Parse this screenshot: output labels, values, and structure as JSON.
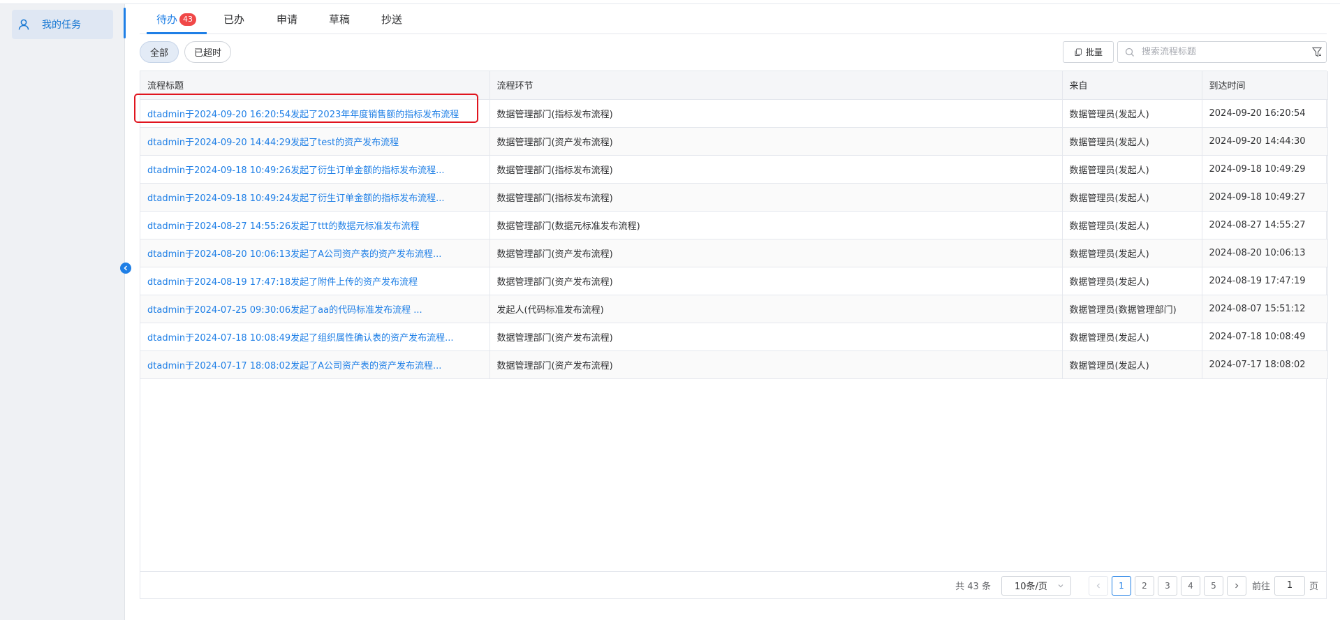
{
  "colors": {
    "accent": "#1f7fe6",
    "badge": "#f04848",
    "highlight": "#e0141e"
  },
  "sidebar": {
    "items": [
      {
        "label": "我的任务",
        "icon": "user-icon"
      }
    ]
  },
  "tabs": [
    {
      "label": "待办",
      "badge": "43",
      "active": true
    },
    {
      "label": "已办"
    },
    {
      "label": "申请"
    },
    {
      "label": "草稿"
    },
    {
      "label": "抄送"
    }
  ],
  "filters": {
    "all": "全部",
    "overdue": "已超时"
  },
  "toolbar": {
    "batch_label": "批量",
    "search_placeholder": "搜索流程标题"
  },
  "table": {
    "columns": [
      "流程标题",
      "流程环节",
      "来自",
      "到达时间"
    ],
    "rows": [
      [
        "dtadmin于2024-09-20 16:20:54发起了2023年年度销售额的指标发布流程",
        "数据管理部门(指标发布流程)",
        "数据管理员(发起人)",
        "2024-09-20 16:20:54"
      ],
      [
        "dtadmin于2024-09-20 14:44:29发起了test的资产发布流程",
        "数据管理部门(资产发布流程)",
        "数据管理员(发起人)",
        "2024-09-20 14:44:30"
      ],
      [
        "dtadmin于2024-09-18 10:49:26发起了衍生订单金额的指标发布流程...",
        "数据管理部门(指标发布流程)",
        "数据管理员(发起人)",
        "2024-09-18 10:49:29"
      ],
      [
        "dtadmin于2024-09-18 10:49:24发起了衍生订单金额的指标发布流程...",
        "数据管理部门(指标发布流程)",
        "数据管理员(发起人)",
        "2024-09-18 10:49:27"
      ],
      [
        "dtadmin于2024-08-27 14:55:26发起了ttt的数据元标准发布流程",
        "数据管理部门(数据元标准发布流程)",
        "数据管理员(发起人)",
        "2024-08-27 14:55:27"
      ],
      [
        "dtadmin于2024-08-20 10:06:13发起了A公司资产表的资产发布流程...",
        "数据管理部门(资产发布流程)",
        "数据管理员(发起人)",
        "2024-08-20 10:06:13"
      ],
      [
        "dtadmin于2024-08-19 17:47:18发起了附件上传的资产发布流程",
        "数据管理部门(资产发布流程)",
        "数据管理员(发起人)",
        "2024-08-19 17:47:19"
      ],
      [
        "dtadmin于2024-07-25 09:30:06发起了aa的代码标准发布流程 ...",
        "发起人(代码标准发布流程)",
        "数据管理员(数据管理部门)",
        "2024-08-07 15:51:12"
      ],
      [
        "dtadmin于2024-07-18 10:08:49发起了组织属性确认表的资产发布流程...",
        "数据管理部门(资产发布流程)",
        "数据管理员(发起人)",
        "2024-07-18 10:08:49"
      ],
      [
        "dtadmin于2024-07-17 18:08:02发起了A公司资产表的资产发布流程...",
        "数据管理部门(资产发布流程)",
        "数据管理员(发起人)",
        "2024-07-17 18:08:02"
      ]
    ]
  },
  "pagination": {
    "total_text": "共 43 条",
    "page_size": "10条/页",
    "pages": [
      "1",
      "2",
      "3",
      "4",
      "5"
    ],
    "current_page": "1",
    "goto_prefix": "前往",
    "goto_value": "1",
    "goto_suffix": "页"
  }
}
